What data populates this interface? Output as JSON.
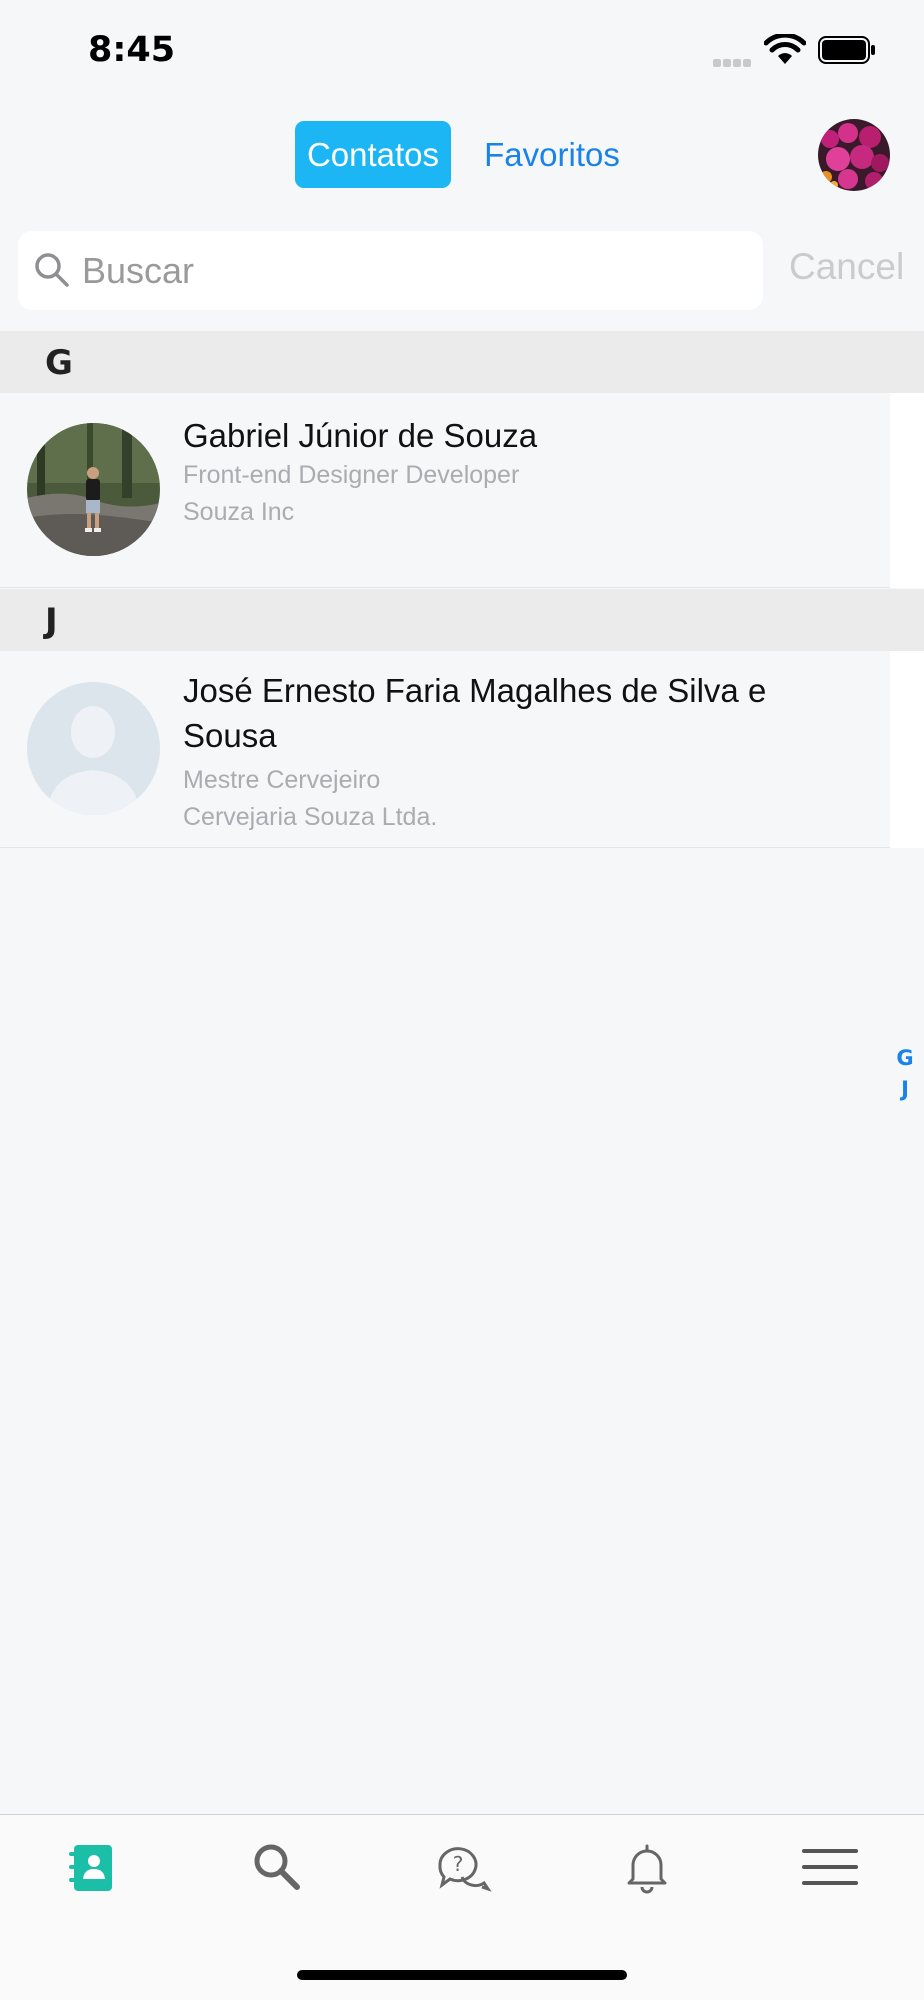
{
  "status_bar": {
    "time": "8:45"
  },
  "header": {
    "tabs": [
      {
        "label": "Contatos",
        "active": true
      },
      {
        "label": "Favoritos",
        "active": false
      }
    ]
  },
  "search": {
    "placeholder": "Buscar",
    "cancel_label": "Cancel"
  },
  "sections": [
    {
      "letter": "G",
      "contacts": [
        {
          "name": "Gabriel Júnior de Souza",
          "role": "Front-end Designer Developer",
          "company": "Souza Inc",
          "avatar": "photo"
        }
      ]
    },
    {
      "letter": "J",
      "contacts": [
        {
          "name": "José Ernesto Faria Magalhes de Silva e Sousa",
          "role": "Mestre Cervejeiro",
          "company": "Cervejaria Souza Ltda.",
          "avatar": "placeholder"
        }
      ]
    }
  ],
  "index_letters": [
    "G",
    "J"
  ],
  "tab_bar": {
    "items": [
      {
        "icon": "contacts-book-icon",
        "active": true
      },
      {
        "icon": "search-icon",
        "active": false
      },
      {
        "icon": "help-chat-icon",
        "active": false
      },
      {
        "icon": "bell-icon",
        "active": false
      },
      {
        "icon": "hamburger-menu-icon",
        "active": false
      }
    ]
  },
  "colors": {
    "accent": "#1a83e8",
    "active_tab_bg": "#1cb6f5",
    "active_bottom_icon": "#1bbfa7"
  }
}
